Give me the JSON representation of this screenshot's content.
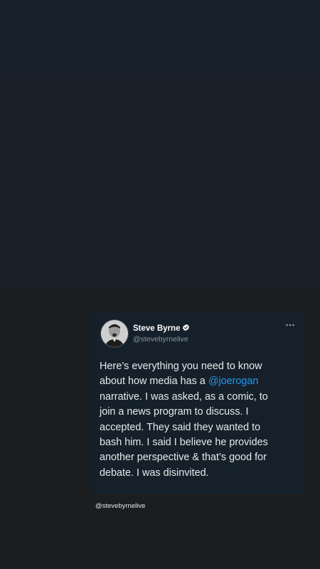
{
  "tweet": {
    "author_name": "Steve Byrne",
    "author_handle": "@stevebyrnelive",
    "verified": true,
    "text_lines": [
      "Here’s everything you need to know",
      "about how media has a ",
      "narrative. I was asked, as a comic, to",
      "join a news program to discuss. I",
      "accepted. They said they wanted to",
      "bash him. I said I believe he provides",
      "another perspective & that’s good for",
      "debate. I was disinvited."
    ],
    "mention": "@joerogan",
    "icons": {
      "verified": "verified-badge-icon",
      "more": "more-options-icon",
      "avatar": "avatar"
    }
  },
  "credit": {
    "handle": "@stevebyrnelive"
  },
  "colors": {
    "card_bg": "#15202b",
    "mention": "#1d9bf0",
    "text": "#e7e9ea",
    "muted": "#8b98a5"
  }
}
